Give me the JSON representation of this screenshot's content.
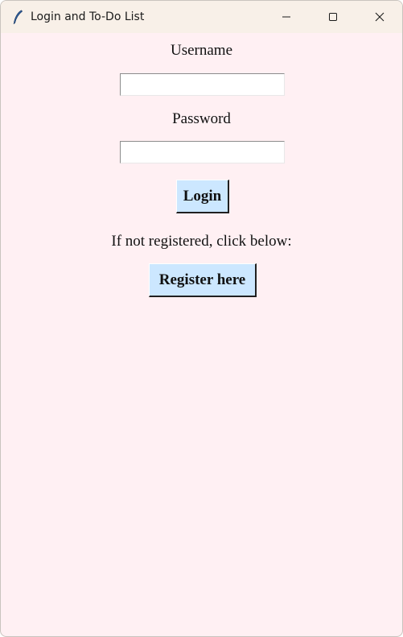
{
  "window": {
    "title": "Login and To-Do List",
    "icon": "feather-icon",
    "controls": [
      "minimize-icon",
      "maximize-icon",
      "close-icon"
    ]
  },
  "form": {
    "username_label": "Username",
    "username_value": "",
    "password_label": "Password",
    "password_value": "",
    "login_button": "Login",
    "register_prompt": "If not registered, click below:",
    "register_button": "Register here"
  },
  "colors": {
    "background": "#fff0f3",
    "titlebar": "#f8f0e8",
    "button": "#cce7ff"
  }
}
